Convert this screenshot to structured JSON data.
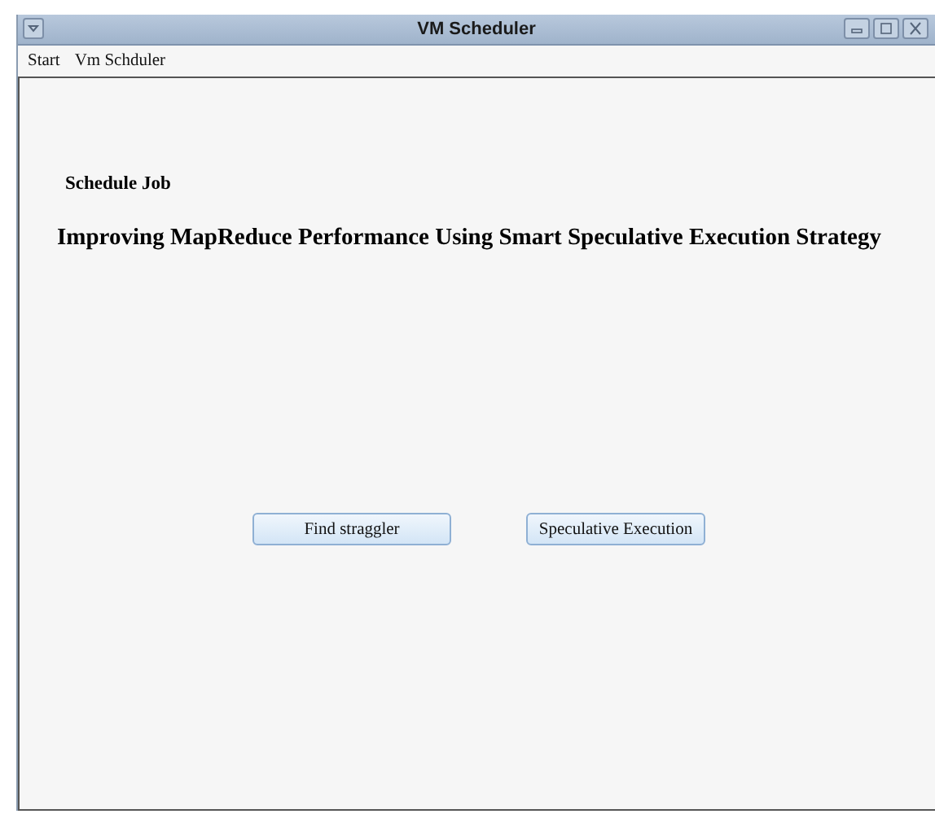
{
  "window": {
    "title": "VM Scheduler"
  },
  "menu": [
    "Start",
    "Vm Schduler"
  ],
  "panel": {
    "label": "Schedule Job",
    "heading": "Improving MapReduce Performance Using Smart Speculative Execution Strategy"
  },
  "buttons": [
    "Find straggler",
    "Speculative Execution"
  ]
}
